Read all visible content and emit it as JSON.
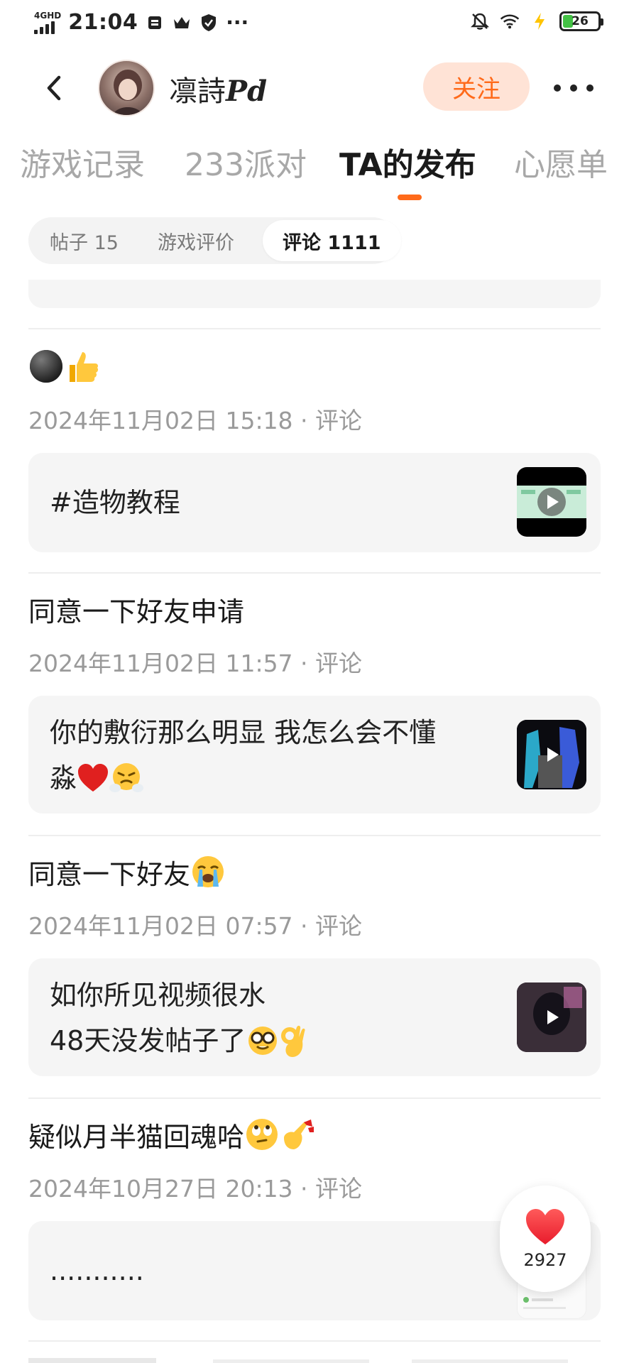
{
  "status_bar": {
    "network": "4GHD",
    "time": "21:04",
    "battery": "26",
    "more": "···"
  },
  "header": {
    "back_icon": "chevron-left-icon",
    "username": "凛詩",
    "username_suffix": "Pd",
    "follow_label": "关注",
    "more_icon": "more-dots-icon"
  },
  "main_tabs": [
    {
      "label": "游戏记录",
      "active": false
    },
    {
      "label": "233派对",
      "active": false
    },
    {
      "label": "TA的发布",
      "active": true
    },
    {
      "label": "心愿单",
      "active": false
    }
  ],
  "sub_tabs": [
    {
      "label": "帖子 15",
      "active": false
    },
    {
      "label": "游戏评价",
      "active": false
    },
    {
      "label": "评论 1111",
      "active": true
    }
  ],
  "comments": [
    {
      "text": "",
      "meta": "2024年11月02日 15:18 · 评论",
      "ref_lines": [
        "#造物教程"
      ]
    },
    {
      "text": "同意一下好友申请",
      "meta": "2024年11月02日 11:57 · 评论",
      "ref_lines": [
        "你的敷衍那么明显 我怎么会不懂",
        "淼"
      ]
    },
    {
      "text": "同意一下好友",
      "meta": "2024年11月02日 07:57 · 评论",
      "ref_lines": [
        "如你所见视频很水",
        "48天没发帖子了"
      ]
    },
    {
      "text": "疑似月半猫回魂哈",
      "meta": "2024年10月27日 20:13 · 评论",
      "ref_lines": [
        "..........."
      ]
    }
  ],
  "like": {
    "count": "2927",
    "icon": "heart-icon"
  },
  "colors": {
    "accent": "#ff6a1a",
    "follow_bg": "#ffe3d6",
    "card_bg": "#f5f5f5",
    "meta_text": "#9a9a9a"
  }
}
